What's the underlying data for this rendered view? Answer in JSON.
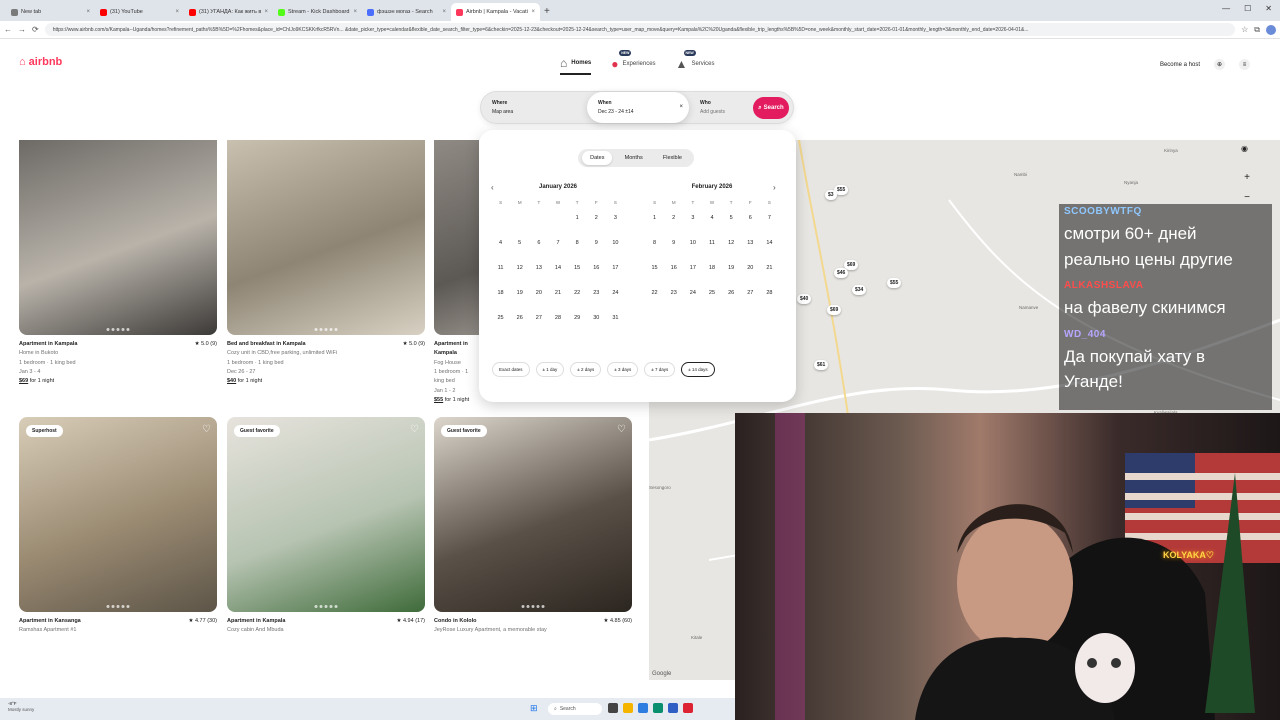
{
  "browser": {
    "tabs": [
      {
        "title": "New tab",
        "color": "#7a7a7a",
        "active": false
      },
      {
        "title": "(31) YouTube",
        "color": "#ff0000",
        "active": false
      },
      {
        "title": "(31) УГАНДА: Как жить в трущоб...",
        "color": "#ff0000",
        "active": false
      },
      {
        "title": "Stream - Kick Dashboard",
        "color": "#53fc18",
        "active": false
      },
      {
        "title": "фэшэн могаз - Search",
        "color": "#4b6eff",
        "active": false
      },
      {
        "title": "Airbnb | Kampala - Vacation Rent...",
        "color": "#ff385c",
        "active": true
      }
    ],
    "new_tab": "+",
    "url": "https://www.airbnb.com/s/Kampala--Uganda/homes?refinement_paths%5B%5D=%2Fhomes&place_id=ChIJo9KCSKKrfkcR5RVn... &date_picker_type=calendar&flexible_date_search_filter_type=6&checkin=2025-12-23&checkout=2025-12-24&search_type=user_map_move&query=Kampala%2C%20Uganda&flexible_trip_lengths%5B%5D=one_week&monthly_start_date=2026-01-01&monthly_length=3&monthly_end_date=2026-04-01&..."
  },
  "header": {
    "logo": "airbnb",
    "nav": [
      {
        "label": "Homes",
        "selected": true,
        "new": false,
        "icon": "house-icon"
      },
      {
        "label": "Experiences",
        "selected": false,
        "new": true,
        "icon": "balloon-icon"
      },
      {
        "label": "Services",
        "selected": false,
        "new": true,
        "icon": "bell-icon"
      }
    ],
    "new_badge": "NEW",
    "become_host": "Become a host"
  },
  "search": {
    "where_label": "Where",
    "where_value": "Map area",
    "when_label": "When",
    "when_value": "Dec 23 - 24  ±14",
    "who_label": "Who",
    "who_placeholder": "Add guests",
    "button": "Search"
  },
  "calendar": {
    "tabs": [
      "Dates",
      "Months",
      "Flexible"
    ],
    "selected_tab": "Dates",
    "dow": [
      "S",
      "M",
      "T",
      "W",
      "T",
      "F",
      "S"
    ],
    "months": [
      {
        "name": "January 2026",
        "offset": 4,
        "days": 31
      },
      {
        "name": "February 2026",
        "offset": 0,
        "days": 28
      }
    ],
    "flex_options": [
      "Exact dates",
      "± 1 day",
      "± 2 days",
      "± 3 days",
      "± 7 days",
      "± 14 days"
    ],
    "selected_flex": "± 14 days"
  },
  "listings": [
    {
      "title": "Apartment in Kampala",
      "rating": "★ 5.0 (9)",
      "sub": "Home in Bukoto",
      "beds": "1 bedroom · 1 king bed",
      "dates": "Jan 3 - 4",
      "price": "$69",
      "per": "for 1 night",
      "badge": "",
      "colors": [
        "#6d6a66",
        "#b9b3aa",
        "#3c3a38"
      ]
    },
    {
      "title": "Bed and breakfast in Kampala",
      "rating": "★ 5.0 (9)",
      "sub": "Cozy unit in CBD,free parking, unlimited WiFi",
      "beds": "1 bedroom · 1 king bed",
      "dates": "Dec 26 - 27",
      "price": "$40",
      "per": "for 1 night",
      "badge": "",
      "colors": [
        "#c9c0b0",
        "#8e8574",
        "#d8d1c3"
      ]
    },
    {
      "title": "Apartment in Kampala",
      "rating": "",
      "sub": "Fog House",
      "beds": "1 bedroom · 1 king bed",
      "dates": "Jan 1 - 2",
      "price": "$55",
      "per": "for 1 night",
      "badge": "",
      "colors": [
        "#8f8a84",
        "#5c5853",
        "#bab4ad"
      ]
    },
    {
      "title": "Apartment in Kansanga",
      "rating": "★ 4.77 (30)",
      "sub": "Ramshas Apartment #1",
      "beds": "",
      "dates": "",
      "price": "",
      "per": "",
      "badge": "Superhost",
      "colors": [
        "#d8cdb8",
        "#9a8a72",
        "#5d5548"
      ]
    },
    {
      "title": "Apartment in Kampala",
      "rating": "★ 4.94 (17)",
      "sub": "Cozy cabin And Mbuda",
      "beds": "",
      "dates": "",
      "price": "",
      "per": "",
      "badge": "Guest favorite",
      "colors": [
        "#e7e3dd",
        "#b7c4b2",
        "#3f6b3a"
      ]
    },
    {
      "title": "Condo in Kololo",
      "rating": "★ 4.85 (60)",
      "sub": "JeyRose Luxury Apartment, a memorable stay",
      "beds": "",
      "dates": "",
      "price": "",
      "per": "",
      "badge": "Guest favorite",
      "colors": [
        "#dcd6cc",
        "#5a5148",
        "#2c2620"
      ]
    }
  ],
  "map": {
    "pins": [
      "$55",
      "$3",
      "$69",
      "$46",
      "$34",
      "$55",
      "$40",
      "$69",
      "$61"
    ],
    "labels": [
      "Kirinya",
      "Nambi",
      "Nyanja",
      "Namanve",
      "Kyaliwajjala",
      "Kira",
      "Sesongoro",
      "Kitale"
    ],
    "attribution": "Google"
  },
  "chat": {
    "messages": [
      {
        "user": "SCOOBYWTFQ",
        "color": "#8fc7ff",
        "text": "смотри 60+ дней реально цены другие"
      },
      {
        "user": "ALKASHSLAVA",
        "color": "#ff4c4c",
        "text": "на фавелу скинимся"
      },
      {
        "user": "WD_404",
        "color": "#b6a6ff",
        "text": "Да покупай хату в Уганде!"
      }
    ]
  },
  "webcam": {
    "sign": "KOLYAKA♡"
  },
  "taskbar": {
    "temp": "-8°F",
    "weather": "Mostly sunny",
    "search": "Search"
  }
}
